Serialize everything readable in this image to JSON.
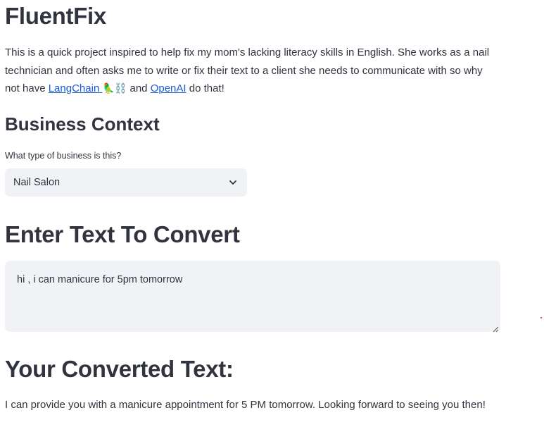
{
  "app": {
    "title": "FluentFix"
  },
  "intro": {
    "text_before": "This is a quick project inspired to help fix my mom's lacking literacy skills in English. She works as a nail technician and often asks me to write or fix their text to a client she needs to communicate with so why not have ",
    "link_langchain": "LangChain",
    "langchain_emojis": "🦜⛓️",
    "text_middle": " and ",
    "link_openai": "OpenAI",
    "text_after": " do that!"
  },
  "business_context": {
    "heading": "Business Context",
    "field_label": "What type of business is this?",
    "selected_value": "Nail Salon",
    "dropdown_icon": "chevron-down-icon"
  },
  "input_section": {
    "heading": "Enter Text To Convert",
    "input_value": "hi , i can manicure for 5pm tomorrow"
  },
  "output_section": {
    "heading": "Your Converted Text:",
    "result": "I can provide you with a manicure appointment for 5 PM tomorrow. Looking forward to seeing you then!"
  },
  "colors": {
    "text": "#31333f",
    "link": "#1c5bd6",
    "input_bg": "#f0f2f6"
  }
}
